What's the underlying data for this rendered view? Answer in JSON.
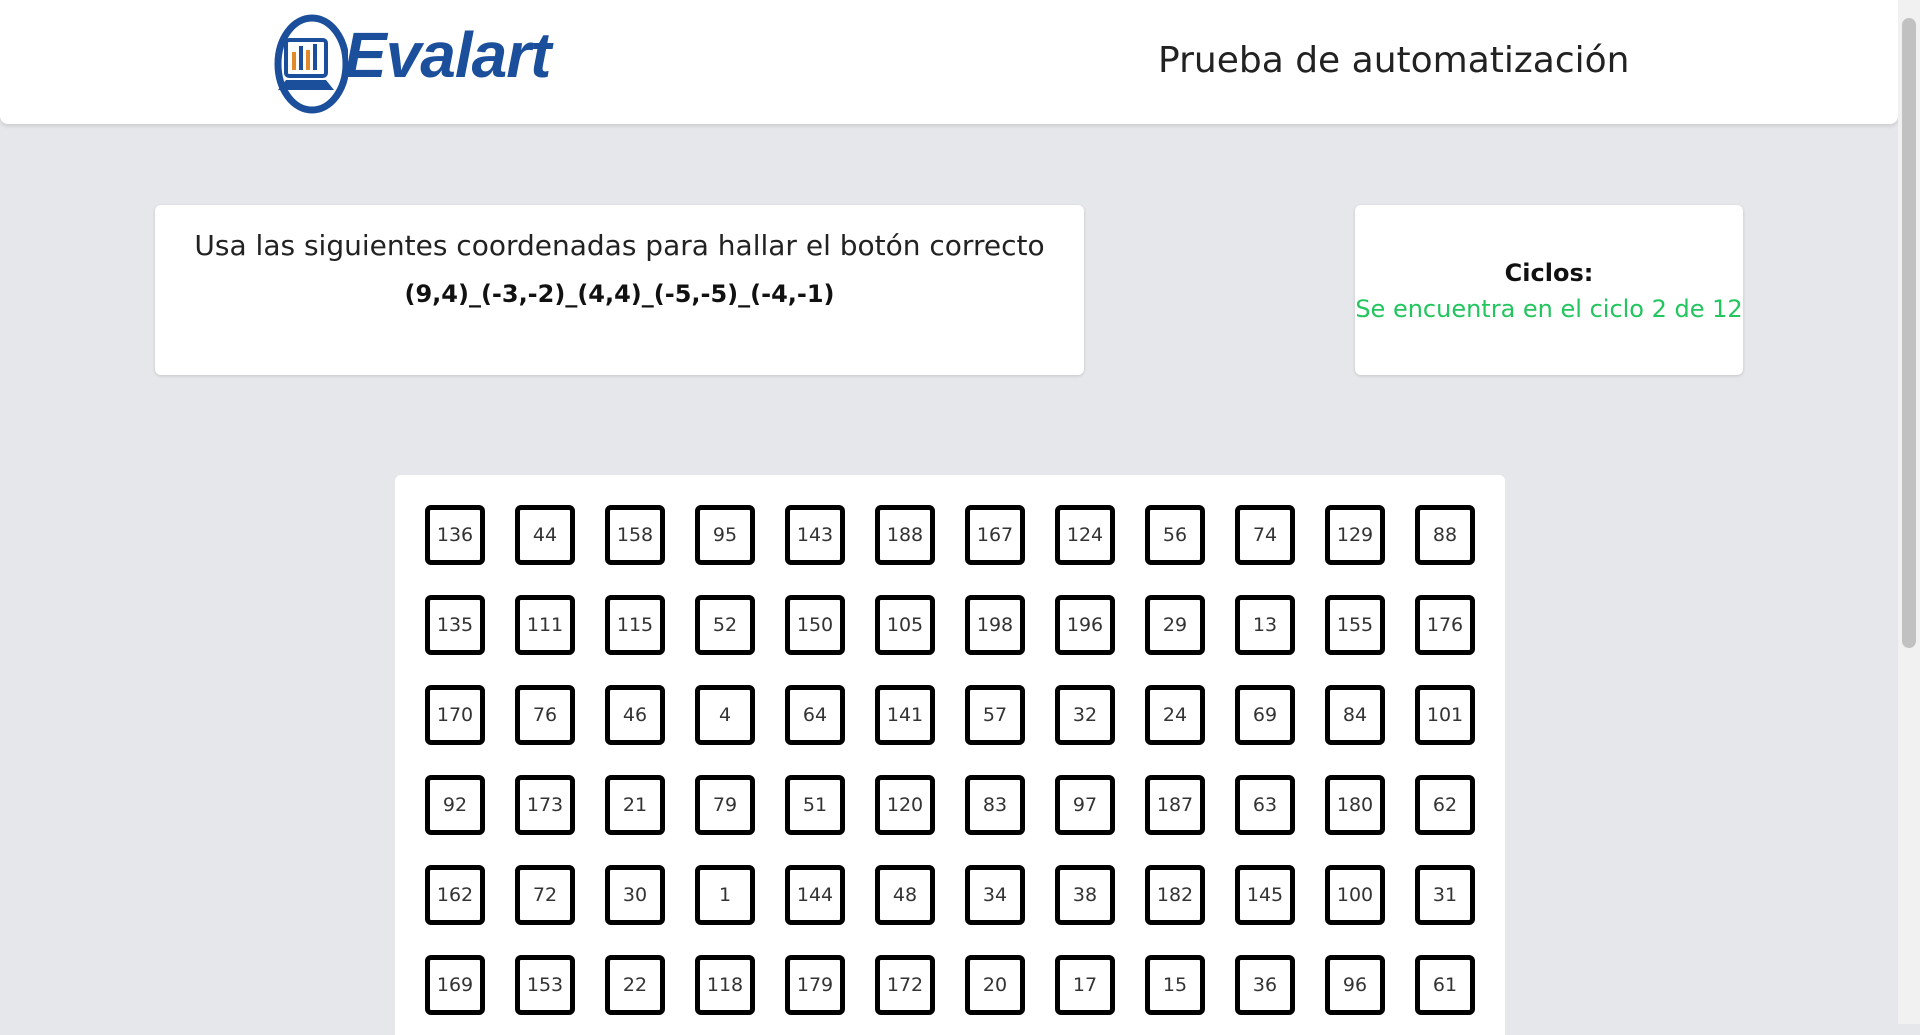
{
  "header": {
    "logo_text": "Evalart",
    "title": "Prueba de automatización"
  },
  "instructions": {
    "text": "Usa las siguientes coordenadas para hallar el botón correcto",
    "coordinates": "(9,4)_(-3,-2)_(4,4)_(-5,-5)_(-4,-1)"
  },
  "cycles": {
    "label": "Ciclos:",
    "status": "Se encuentra en el ciclo 2 de 12"
  },
  "grid": {
    "cells": [
      "136",
      "44",
      "158",
      "95",
      "143",
      "188",
      "167",
      "124",
      "56",
      "74",
      "129",
      "88",
      "135",
      "111",
      "115",
      "52",
      "150",
      "105",
      "198",
      "196",
      "29",
      "13",
      "155",
      "176",
      "170",
      "76",
      "46",
      "4",
      "64",
      "141",
      "57",
      "32",
      "24",
      "69",
      "84",
      "101",
      "92",
      "173",
      "21",
      "79",
      "51",
      "120",
      "83",
      "97",
      "187",
      "63",
      "180",
      "62",
      "162",
      "72",
      "30",
      "1",
      "144",
      "48",
      "34",
      "38",
      "182",
      "145",
      "100",
      "31",
      "169",
      "153",
      "22",
      "118",
      "179",
      "172",
      "20",
      "17",
      "15",
      "36",
      "96",
      "61"
    ]
  },
  "colors": {
    "background": "#e5e7eb",
    "logo": "#1b4f9c",
    "status_green": "#22c55e"
  }
}
